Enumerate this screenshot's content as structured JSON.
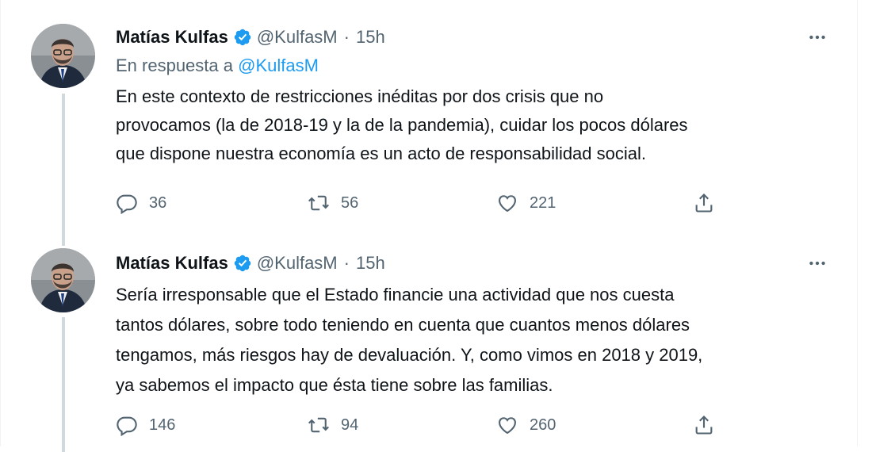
{
  "tweets": [
    {
      "author": {
        "name": "Matías Kulfas",
        "handle": "@KulfasM",
        "time": "15h",
        "verified": true
      },
      "reply_prefix": "En respuesta a ",
      "reply_to": "@KulfasM",
      "text": "En este contexto de restricciones inéditas por dos crisis que no\nprovocamos (la de 2018-19 y la de la pandemia), cuidar los pocos dólares\nque dispone nuestra economía es un acto de responsabilidad social.",
      "stats": {
        "replies": "36",
        "retweets": "56",
        "likes": "221"
      }
    },
    {
      "author": {
        "name": "Matías Kulfas",
        "handle": "@KulfasM",
        "time": "15h",
        "verified": true
      },
      "text": "Sería irresponsable que el Estado financie una actividad que nos cuesta\ntantos dólares, sobre todo teniendo en cuenta que cuantos menos dólares\ntengamos, más riesgos hay de devaluación. Y, como vimos en 2018 y 2019,\nya sabemos el impacto que ésta tiene sobre las familias.",
      "stats": {
        "replies": "146",
        "retweets": "94",
        "likes": "260"
      }
    }
  ],
  "dot": "·",
  "icons": {
    "verified": "verified-badge-icon",
    "more": "more-icon",
    "reply": "reply-icon",
    "retweet": "retweet-icon",
    "like": "like-icon",
    "share": "share-icon"
  },
  "colors": {
    "accent": "#1d9bf0",
    "secondary_text": "#536471",
    "primary_text": "#0f1419",
    "thread_line": "#cfd9de"
  }
}
